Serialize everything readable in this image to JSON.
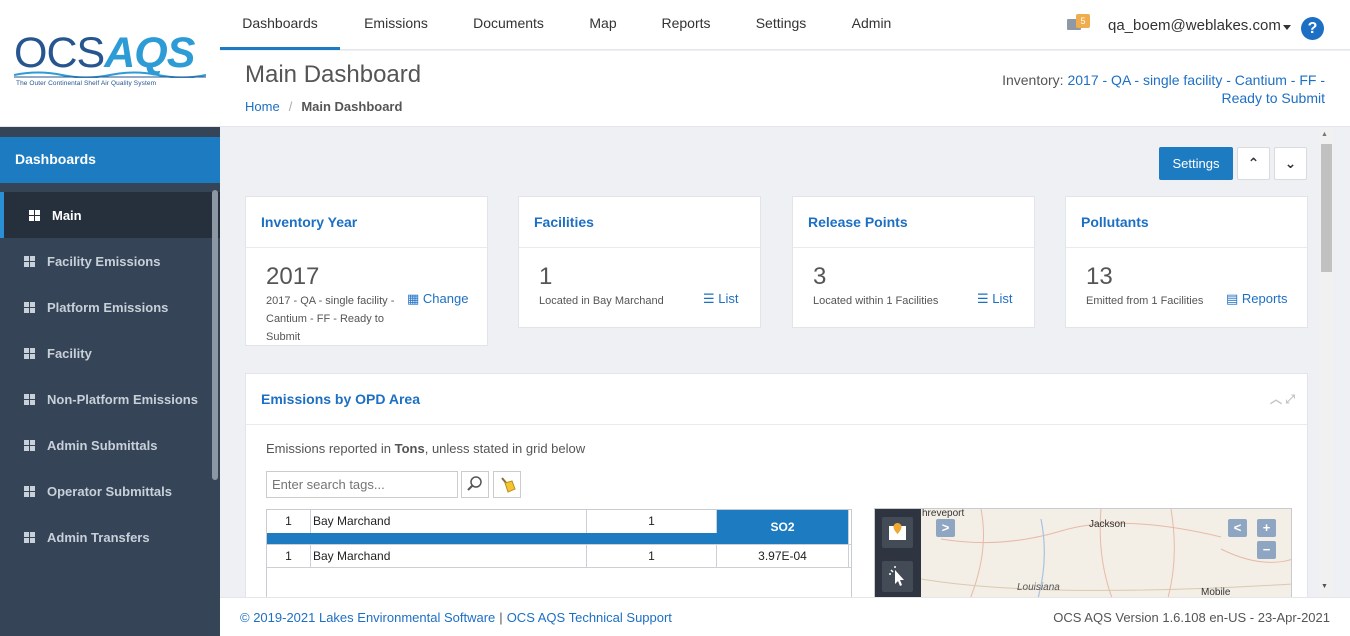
{
  "logo": {
    "word_part1": "OCS",
    "word_part2": "AQS",
    "tagline": "The Outer Continental Shelf Air Quality System"
  },
  "sidebar": {
    "section_title": "Dashboards",
    "items": [
      {
        "label": "Main",
        "active": true
      },
      {
        "label": "Facility Emissions"
      },
      {
        "label": "Platform Emissions"
      },
      {
        "label": "Facility"
      },
      {
        "label": "Non-Platform Emissions"
      },
      {
        "label": "Admin Submittals"
      },
      {
        "label": "Operator Submittals"
      },
      {
        "label": "Admin Transfers"
      }
    ]
  },
  "nav": {
    "tabs": [
      "Dashboards",
      "Emissions",
      "Documents",
      "Map",
      "Reports",
      "Settings",
      "Admin"
    ],
    "active_tab": "Dashboards",
    "mail_badge": "5",
    "user_email": "qa_boem@weblakes.com",
    "help": "?"
  },
  "header": {
    "title": "Main Dashboard",
    "breadcrumb": {
      "home": "Home",
      "current": "Main Dashboard"
    },
    "inventory_label": "Inventory:",
    "inventory_value": "2017 - QA - single facility - Cantium - FF - Ready to Submit"
  },
  "toolbar": {
    "settings_label": "Settings",
    "collapse_all": "⌃",
    "expand_all": "⌄"
  },
  "cards": {
    "inventory_year": {
      "title": "Inventory Year",
      "value": "2017",
      "detail": "2017 - QA - single facility - Cantium - FF - Ready to Submit",
      "link": "Change"
    },
    "facilities": {
      "title": "Facilities",
      "value": "1",
      "detail": "Located in Bay Marchand",
      "link": "List"
    },
    "release_points": {
      "title": "Release Points",
      "value": "3",
      "detail": "Located within 1 Facilities",
      "link": "List"
    },
    "pollutants": {
      "title": "Pollutants",
      "value": "13",
      "detail": "Emitted from 1 Facilities",
      "link": "Reports"
    }
  },
  "emissions_panel": {
    "title": "Emissions by OPD Area",
    "note_prefix": "Emissions reported in ",
    "note_unit": "Tons",
    "note_suffix": ", unless stated in grid below",
    "search_placeholder": "Enter search tags...",
    "grid": {
      "header_row": {
        "num": "1",
        "area": "Bay Marchand",
        "count": "1",
        "column": "SO2"
      },
      "rows": [
        {
          "num": "1",
          "area": "Bay Marchand",
          "count": "1",
          "so2": "3.97E-04"
        }
      ]
    },
    "map_labels": {
      "city1": "hreveport",
      "city2": "Jackson",
      "state": "Louisiana",
      "city3": "Mobile"
    },
    "map_buttons": {
      "expand": ">",
      "collapse": "<",
      "zoom_in": "+",
      "zoom_out": "−"
    }
  },
  "footer": {
    "copyright": "© 2019-2021 Lakes Environmental Software",
    "support": "OCS AQS Technical Support",
    "version": "OCS AQS Version 1.6.108 en-US - 23-Apr-2021"
  },
  "colors": {
    "primary": "#1d7bc2",
    "sidebar_bg": "#354456",
    "link": "#1d6fc4",
    "badge": "#f0ad4e"
  }
}
